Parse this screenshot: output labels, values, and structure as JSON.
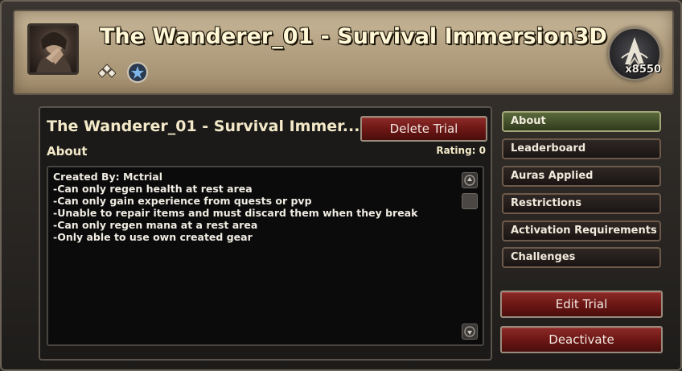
{
  "header": {
    "title": "The Wanderer_01 - Survival Immersion3D",
    "points": "x8550",
    "icons": [
      "portrait-avatar",
      "difficulty-icon",
      "star-badge-icon",
      "emblem-icon"
    ]
  },
  "panel": {
    "trial_name": "The Wanderer_01 - Survival Immer...",
    "delete_label": "Delete Trial",
    "section_label": "About",
    "rating": "Rating: 0",
    "description": [
      "Created By: Mctrial",
      "-Can only regen health at rest area",
      "-Can only gain experience from quests or pvp",
      "-Unable to repair items and must discard them when they break",
      "-Can only regen mana at a rest area",
      "-Only able to use own created gear"
    ]
  },
  "sidebar": {
    "tabs": [
      {
        "label": "About",
        "active": true
      },
      {
        "label": "Leaderboard",
        "active": false
      },
      {
        "label": "Auras Applied",
        "active": false
      },
      {
        "label": "Restrictions",
        "active": false
      },
      {
        "label": "Activation Requirements",
        "active": false
      },
      {
        "label": "Challenges",
        "active": false
      }
    ],
    "edit_label": "Edit Trial",
    "deactivate_label": "Deactivate"
  },
  "colors": {
    "header_parchment": "#b5a283",
    "button_red": "#6a1614",
    "active_tab_green": "#5a6a3c",
    "text_cream": "#f3e9c8"
  }
}
